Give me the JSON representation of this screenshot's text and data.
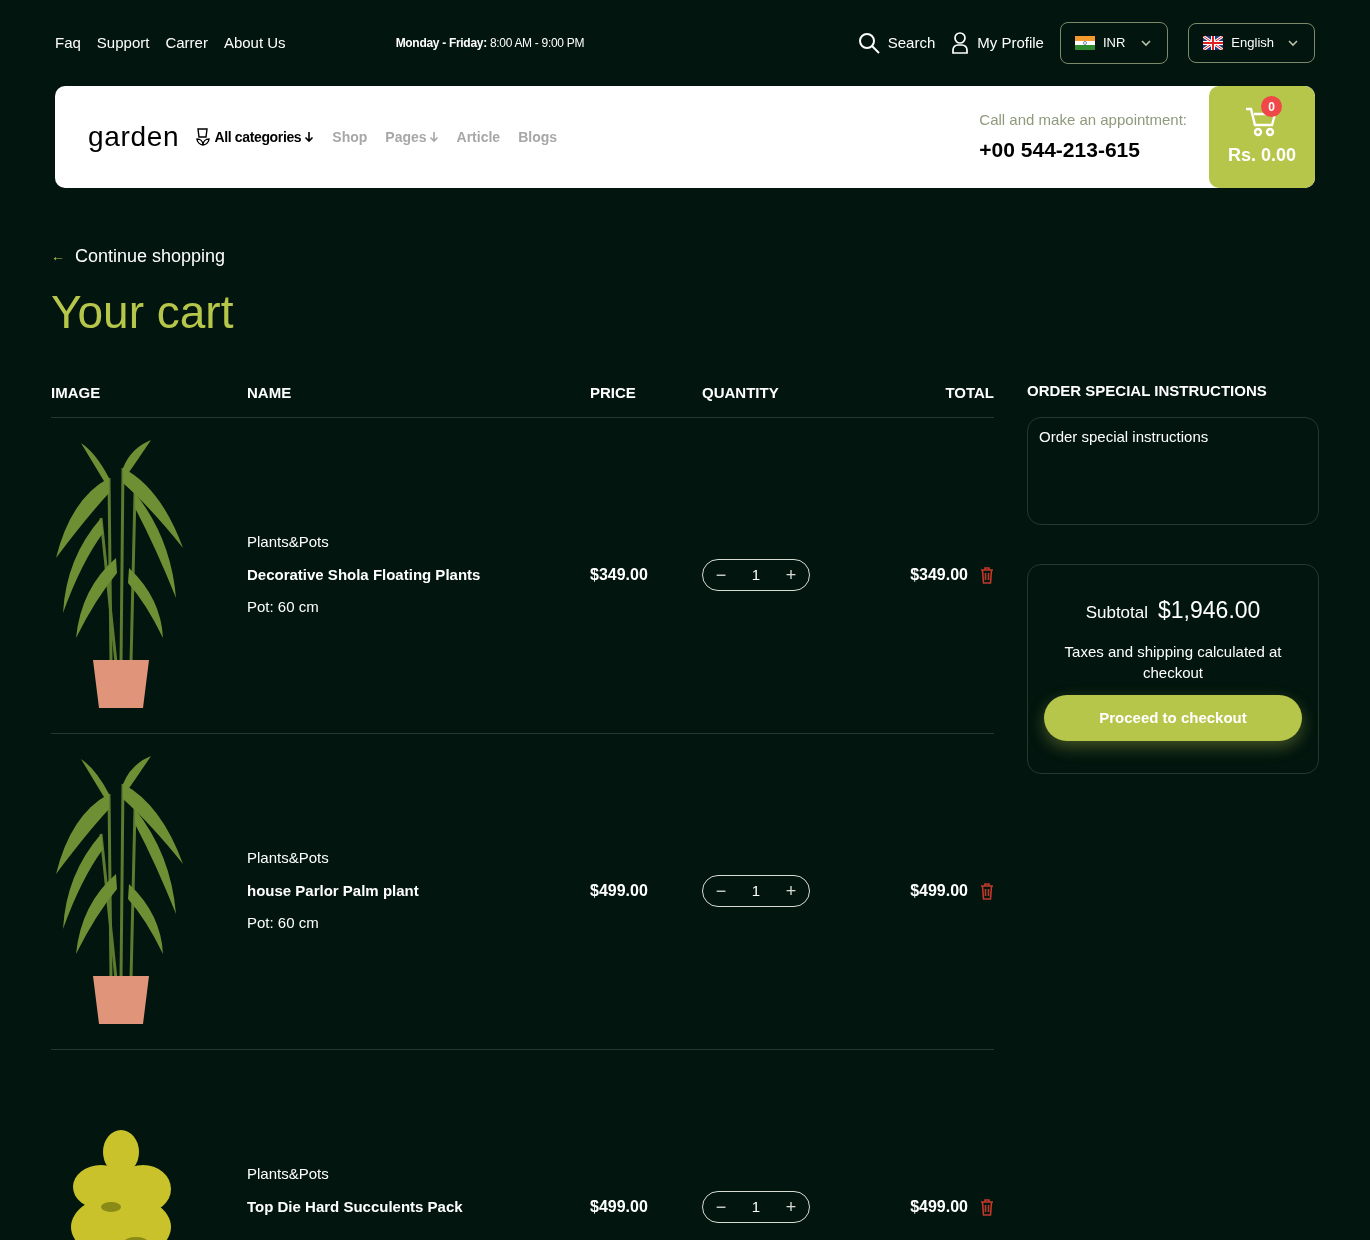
{
  "top_links": [
    "Faq",
    "Support",
    "Carrer",
    "About Us"
  ],
  "hours": {
    "days": "Monday - Friday:",
    "time": "8:00 AM - 9:00 PM"
  },
  "top_actions": {
    "search": "Search",
    "profile": "My Profile"
  },
  "currency": {
    "label": "INR"
  },
  "language": {
    "label": "English"
  },
  "header": {
    "logo": "garden",
    "nav": [
      {
        "label": "All categories",
        "kind": "categories",
        "dropdown": true
      },
      {
        "label": "Shop",
        "kind": "plain",
        "dropdown": false
      },
      {
        "label": "Pages",
        "kind": "plain",
        "dropdown": true
      },
      {
        "label": "Article",
        "kind": "plain",
        "dropdown": false
      },
      {
        "label": "Blogs",
        "kind": "plain",
        "dropdown": false
      }
    ],
    "call_label": "Call and make an appointment:",
    "phone": "+00 544-213-615",
    "cart_count": "0",
    "cart_total": "Rs. 0.00"
  },
  "back_link": "Continue shopping",
  "back_arrow": "←",
  "title": "Your cart",
  "table": {
    "columns": [
      "IMAGE",
      "NAME",
      "PRICE",
      "QUANTITY",
      "TOTAL"
    ],
    "rows": [
      {
        "kind": "palm",
        "vendor": "Plants&Pots",
        "name": "Decorative Shola Floating Plants",
        "variant": "Pot: 60 cm",
        "price": "$349.00",
        "minus": "−",
        "qty": "1",
        "plus": "+",
        "total": "$349.00"
      },
      {
        "kind": "palm",
        "vendor": "Plants&Pots",
        "name": "house Parlor Palm plant",
        "variant": "Pot: 60 cm",
        "price": "$499.00",
        "minus": "−",
        "qty": "1",
        "plus": "+",
        "total": "$499.00"
      },
      {
        "kind": "bush",
        "vendor": "Plants&Pots",
        "name": "Top Die Hard Succulents Pack",
        "variant": "",
        "price": "$499.00",
        "minus": "−",
        "qty": "1",
        "plus": "+",
        "total": "$499.00"
      }
    ]
  },
  "instructions": {
    "heading": "ORDER SPECIAL INSTRUCTIONS",
    "placeholder": "Order special instructions"
  },
  "summary": {
    "label": "Subtotal",
    "amount": "$1,946.00",
    "note": "Taxes and shipping calculated at checkout",
    "button": "Proceed to checkout"
  }
}
